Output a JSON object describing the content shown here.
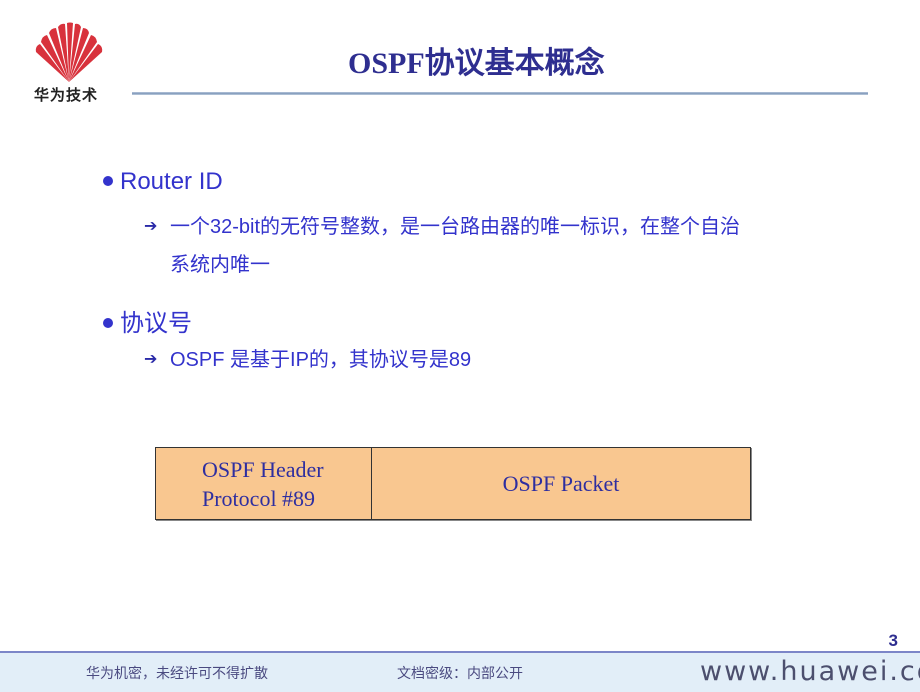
{
  "logo": {
    "icon": "huawei-fan-logo-icon",
    "text": "华为技术"
  },
  "title": "OSPF协议基本概念",
  "bullets": [
    {
      "label": "Router ID",
      "sub": [
        {
          "line1": "一个32-bit的无符号整数，是一台路由器的唯一标识，在整个自治",
          "line2": "系统内唯一"
        }
      ]
    },
    {
      "label": "协议号",
      "sub": [
        {
          "line1": "OSPF 是基于IP的，其协议号是89"
        }
      ]
    }
  ],
  "packet_diagram": {
    "header_line1": "OSPF Header",
    "header_line2": "Protocol #89",
    "payload": "OSPF Packet",
    "fill_color": "#f9c790"
  },
  "page_number": "3",
  "footer": {
    "confidential": "华为机密，未经许可不得扩散",
    "classification": "文档密级：内部公开",
    "url": "www.huawei.com"
  },
  "colors": {
    "title": "#2e2e90",
    "text": "#3333cc"
  }
}
